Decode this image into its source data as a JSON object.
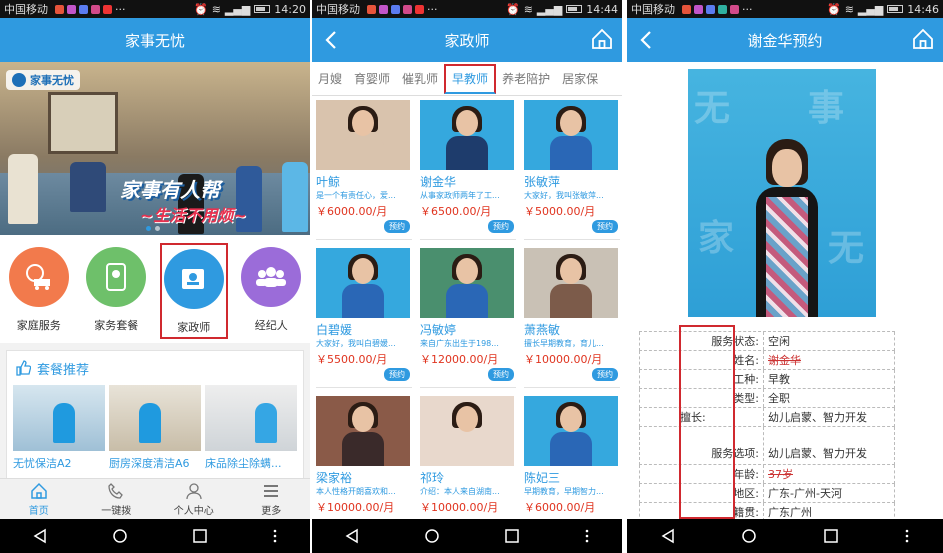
{
  "status": [
    {
      "carrier": "中国移动",
      "time": "14:20"
    },
    {
      "carrier": "中国移动",
      "time": "14:44"
    },
    {
      "carrier": "中国移动",
      "time": "14:46"
    }
  ],
  "home": {
    "title": "家事无忧",
    "banner": {
      "logo": "家事无忧",
      "slogan1": "家事有人帮",
      "slogan2": "~生活不用烦~"
    },
    "categories": [
      {
        "label": "家庭服务",
        "color": "#f27a4c"
      },
      {
        "label": "家务套餐",
        "color": "#6ec06a"
      },
      {
        "label": "家政师",
        "color": "#2f9ae0"
      },
      {
        "label": "经纪人",
        "color": "#9b6cd9"
      }
    ],
    "package_title": "套餐推荐",
    "packages": [
      "无忧保洁A2",
      "厨房深度清洁A6",
      "床品除尘除螨..."
    ],
    "tabs": [
      "首页",
      "一键拨",
      "个人中心",
      "更多"
    ]
  },
  "list": {
    "title": "家政师",
    "subtabs": [
      "月嫂",
      "育婴师",
      "催乳师",
      "早教师",
      "养老陪护",
      "居家保"
    ],
    "book_label": "预约",
    "workers": [
      {
        "name": "叶鲸",
        "desc": "是一个有责任心，爱...",
        "price": "￥6000.00/月"
      },
      {
        "name": "谢金华",
        "desc": "从事家政师两年了工...",
        "price": "￥6500.00/月"
      },
      {
        "name": "张敏萍",
        "desc": "大家好，我叫张敏萍...",
        "price": "￥5000.00/月"
      },
      {
        "name": "白碧媛",
        "desc": "大家好，我叫白碧媛...",
        "price": "￥5500.00/月"
      },
      {
        "name": "冯敏婷",
        "desc": "来自广东出生于198...",
        "price": "￥12000.00/月"
      },
      {
        "name": "萧燕敏",
        "desc": "擅长早期教育，育儿...",
        "price": "￥10000.00/月"
      },
      {
        "name": "梁家裕",
        "desc": "本人性格开朗喜欢和...",
        "price": "￥10000.00/月"
      },
      {
        "name": "祁玲",
        "desc": "介绍：本人来自湖南...",
        "price": "￥10000.00/月"
      },
      {
        "name": "陈妃三",
        "desc": "早期教育，早期智力...",
        "price": "￥6000.00/月"
      }
    ]
  },
  "detail": {
    "title": "谢金华预约",
    "fields": [
      {
        "k": "服务状态:",
        "v": "空闲"
      },
      {
        "k": "姓名:",
        "v": "谢金华"
      },
      {
        "k": "工种:",
        "v": "早教"
      },
      {
        "k": "类型:",
        "v": "全职"
      },
      {
        "k": "擅长:",
        "v": "幼儿启蒙、智力开发"
      },
      {
        "k": "服务选项:",
        "v": "幼儿启蒙、智力开发"
      },
      {
        "k": "年龄:",
        "v": "37岁"
      },
      {
        "k": "地区:",
        "v": "广东-广州-天河"
      },
      {
        "k": "籍贯:",
        "v": "广东广州"
      }
    ]
  }
}
